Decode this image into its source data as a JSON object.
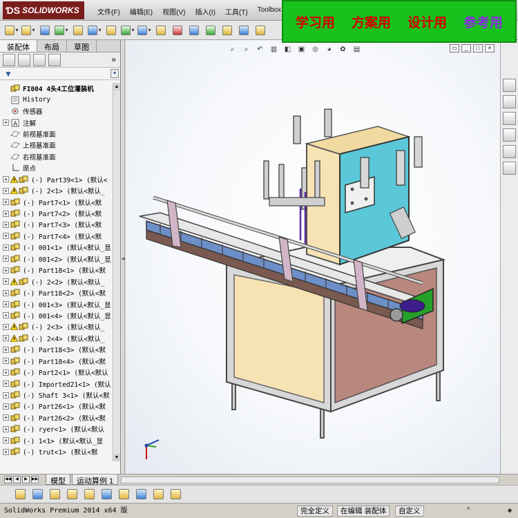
{
  "app": {
    "brand": "SOLIDWORKS",
    "menu": [
      "文件(F)",
      "编辑(E)",
      "视图(V)",
      "插入(I)",
      "工具(T)",
      "Toolbox"
    ]
  },
  "banner": {
    "items": [
      {
        "text": "学习用",
        "color": "#d10000"
      },
      {
        "text": "方案用",
        "color": "#d10000"
      },
      {
        "text": "设计用",
        "color": "#d10000"
      },
      {
        "text": "参考用",
        "color": "#8a2be2"
      }
    ],
    "background": "#19c11c"
  },
  "panel_tabs": [
    "装配体",
    "布局",
    "草图"
  ],
  "tree": {
    "root": "FI004 4头4工位灌装机",
    "nodes": [
      {
        "label": "History",
        "pm": "",
        "warn": false,
        "icon": "history-icon"
      },
      {
        "label": "传感器",
        "pm": "",
        "warn": false,
        "icon": "sensor-icon"
      },
      {
        "label": "注解",
        "pm": "+",
        "warn": false,
        "icon": "annotation-icon"
      },
      {
        "label": "前视基准面",
        "pm": "",
        "warn": false,
        "icon": "plane-icon"
      },
      {
        "label": "上视基准面",
        "pm": "",
        "warn": false,
        "icon": "plane-icon"
      },
      {
        "label": "右视基准面",
        "pm": "",
        "warn": false,
        "icon": "plane-icon"
      },
      {
        "label": "原点",
        "pm": "",
        "warn": false,
        "icon": "origin-icon"
      },
      {
        "label": "(-) Part39<1> (默认<",
        "pm": "+",
        "warn": true,
        "icon": "part-icon"
      },
      {
        "label": "(-) 2<1> (默认<默认_",
        "pm": "+",
        "warn": true,
        "icon": "part-icon"
      },
      {
        "label": "(-) Part7<1> (默认<默",
        "pm": "+",
        "warn": false,
        "icon": "part-icon"
      },
      {
        "label": "(-) Part7<2> (默认<默",
        "pm": "+",
        "warn": false,
        "icon": "part-icon"
      },
      {
        "label": "(-) Part7<3> (默认<默",
        "pm": "+",
        "warn": false,
        "icon": "part-icon"
      },
      {
        "label": "(-) Part7<4> (默认<默",
        "pm": "+",
        "warn": false,
        "icon": "part-icon"
      },
      {
        "label": "(-) 001<1> (默认<默认_显",
        "pm": "+",
        "warn": false,
        "icon": "part-icon"
      },
      {
        "label": "(-) 001<2> (默认<默认_显",
        "pm": "+",
        "warn": false,
        "icon": "part-icon"
      },
      {
        "label": "(-) Part18<1> (默认<默",
        "pm": "+",
        "warn": false,
        "icon": "part-icon"
      },
      {
        "label": "(-) 2<2> (默认<默认_",
        "pm": "+",
        "warn": true,
        "icon": "part-icon"
      },
      {
        "label": "(-) Part18<2> (默认<默",
        "pm": "+",
        "warn": false,
        "icon": "part-icon"
      },
      {
        "label": "(-) 001<3> (默认<默认_显",
        "pm": "+",
        "warn": false,
        "icon": "part-icon"
      },
      {
        "label": "(-) 001<4> (默认<默认_显",
        "pm": "+",
        "warn": false,
        "icon": "part-icon"
      },
      {
        "label": "(-) 2<3> (默认<默认_",
        "pm": "+",
        "warn": true,
        "icon": "part-icon"
      },
      {
        "label": "(-) 2<4> (默认<默认_",
        "pm": "+",
        "warn": true,
        "icon": "part-icon"
      },
      {
        "label": "(-) Part18<3> (默认<默",
        "pm": "+",
        "warn": false,
        "icon": "part-icon"
      },
      {
        "label": "(-) Part18<4> (默认<默",
        "pm": "+",
        "warn": false,
        "icon": "part-icon"
      },
      {
        "label": "(-) Part2<1> (默认<默认",
        "pm": "+",
        "warn": false,
        "icon": "part-icon"
      },
      {
        "label": "(-) Imported21<1> (默认",
        "pm": "+",
        "warn": false,
        "icon": "part-icon"
      },
      {
        "label": "(-) Shaft 3<1> (默认<默",
        "pm": "+",
        "warn": false,
        "icon": "part-icon"
      },
      {
        "label": "(-) Part26<1> (默认<默",
        "pm": "+",
        "warn": false,
        "icon": "part-icon"
      },
      {
        "label": "(-) Part26<2> (默认<默",
        "pm": "+",
        "warn": false,
        "icon": "part-icon"
      },
      {
        "label": "(-) ryer<1> (默认<默认",
        "pm": "+",
        "warn": false,
        "icon": "part-icon"
      },
      {
        "label": "(-) 1<1> (默认<默认_显",
        "pm": "+",
        "warn": false,
        "icon": "part-icon"
      },
      {
        "label": "(-) trut<1> (默认<默",
        "pm": "+",
        "warn": false,
        "icon": "part-icon"
      }
    ]
  },
  "bottom_tabs": [
    "模型",
    "运动算例 1"
  ],
  "status": {
    "version": "SolidWorks Premium 2014 x64 版",
    "state": "完全定义",
    "editing": "在编辑 装配体",
    "custom": "自定义"
  },
  "colors": {
    "accent": "#1f5fbf",
    "panel": "#f4f4f4",
    "conveyor": "#6d8fc7",
    "frame_fill": "#f6e2b3",
    "cabinet_fill": "#b8877d",
    "electrical_box": "#5ac8d8"
  }
}
